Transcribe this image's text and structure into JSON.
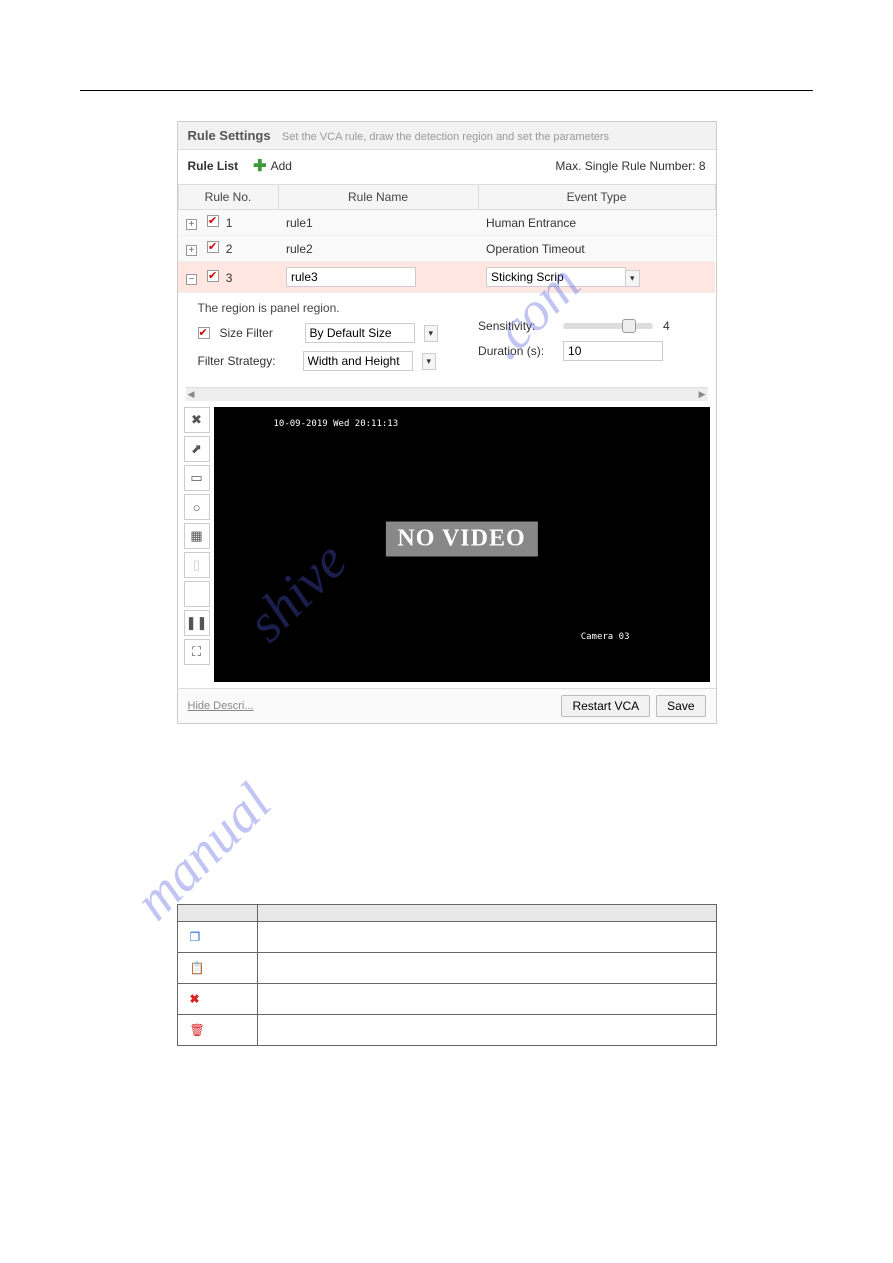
{
  "panel": {
    "title": "Rule Settings",
    "subtitle": "Set the VCA rule, draw the detection region and set the parameters",
    "rule_list_label": "Rule List",
    "add_label": "Add",
    "max_rule_label": "Max. Single Rule Number: 8"
  },
  "headers": {
    "rule_no": "Rule No.",
    "rule_name": "Rule Name",
    "event_type": "Event Type"
  },
  "rules": [
    {
      "no": "1",
      "name": "rule1",
      "event": "Human Entrance",
      "expand": "+",
      "active": false
    },
    {
      "no": "2",
      "name": "rule2",
      "event": "Operation Timeout",
      "expand": "+",
      "active": false
    },
    {
      "no": "3",
      "name": "rule3",
      "event": "Sticking Scrip",
      "expand": "−",
      "active": true
    }
  ],
  "detail": {
    "region_note": "The region is panel region.",
    "size_filter_label": "Size Filter",
    "size_filter_value": "By Default Size",
    "filter_strategy_label": "Filter Strategy:",
    "filter_strategy_value": "Width and Height",
    "sensitivity_label": "Sensitivity:",
    "sensitivity_value": "4",
    "duration_label": "Duration (s):",
    "duration_value": "10"
  },
  "video": {
    "timestamp": "10-09-2019 Wed 20:11:13",
    "no_video": "NO VIDEO",
    "camera": "Camera 03"
  },
  "footer": {
    "hide_label": "Hide Descri...",
    "restart_label": "Restart VCA",
    "save_label": "Save"
  },
  "watermark": "manualshive.com",
  "icon_table": {
    "headers": {
      "icon": "",
      "desc": ""
    },
    "rows": [
      {
        "glyph": "❐",
        "cls": "copy-icon"
      },
      {
        "glyph": "📋",
        "cls": "paste-icon"
      },
      {
        "glyph": "✖",
        "cls": "x-icon"
      },
      {
        "glyph": "🗑",
        "cls": "trash-icon"
      }
    ]
  }
}
